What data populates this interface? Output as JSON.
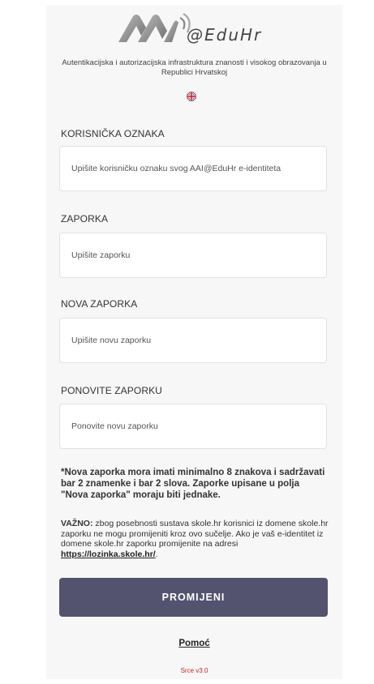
{
  "header": {
    "logo_text": "@EduHr",
    "subtitle": "Autentikacijska i autorizacijska infrastruktura znanosti i visokog obrazovanja u Republici Hrvatskoj",
    "language_flag": "uk-flag-icon"
  },
  "fields": {
    "username": {
      "label": "KORISNIČKA OZNAKA",
      "placeholder": "Upišite korisničku oznaku svog AAI@EduHr e-identiteta",
      "value": ""
    },
    "password": {
      "label": "ZAPORKA",
      "placeholder": "Upišite zaporku",
      "value": ""
    },
    "new_password": {
      "label": "NOVA ZAPORKA",
      "placeholder": "Upišite novu zaporku",
      "value": ""
    },
    "repeat_password": {
      "label": "PONOVITE ZAPORKU",
      "placeholder": "Ponovite novu zaporku",
      "value": ""
    }
  },
  "note": "*Nova zaporka mora imati minimalno 8 znakova i sadržavati bar 2 znamenke i bar 2 slova. Zaporke upisane u polja \"Nova zaporka\" moraju biti jednake.",
  "important": {
    "prefix": "VAŽNO:",
    "text": " zbog posebnosti sustava skole.hr korisnici iz domene skole.hr zaporku ne mogu promijeniti kroz ovo sučelje. Ako je vaš e-identitet iz domene skole.hr zaporku promijenite na adresi ",
    "link": "https://lozinka.skole.hr/",
    "suffix": "."
  },
  "submit_label": "PROMIJENI",
  "help_link": "Pomoć",
  "version": "Srce v3.0",
  "colors": {
    "button": "#535370",
    "version": "#c62828",
    "background": "#f7f7f7"
  }
}
